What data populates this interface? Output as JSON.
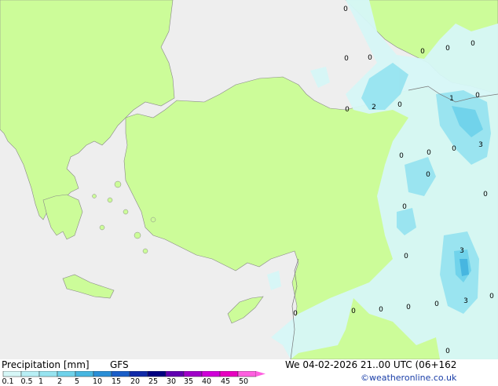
{
  "legend": {
    "title": "Precipitation [mm]",
    "model": "GFS",
    "ticks": [
      "0.1",
      "0.5",
      "1",
      "2",
      "5",
      "10",
      "15",
      "20",
      "25",
      "30",
      "35",
      "40",
      "45",
      "50"
    ],
    "colors": [
      "#d6f7f7",
      "#b8eff5",
      "#97e4f0",
      "#6fd2ea",
      "#47b6e0",
      "#2a8ed6",
      "#1a5ec8",
      "#102aa8",
      "#000080",
      "#6000b0",
      "#a000c8",
      "#d000d8",
      "#e800c0",
      "#ff60e0"
    ]
  },
  "run_info": {
    "datetime": "We 04-02-2026 21..00 UTC (06+162",
    "credit": "©weatheronline.co.uk"
  },
  "map": {
    "land_color": "#ccfc99",
    "sea_color": "#eeeeee",
    "outside_color": "#eeeeee",
    "labels": [
      {
        "text": "0"
      },
      {
        "text": "0"
      },
      {
        "text": "0"
      },
      {
        "text": "0"
      },
      {
        "text": "0"
      },
      {
        "text": "0"
      },
      {
        "text": "0"
      },
      {
        "text": "2"
      },
      {
        "text": "0"
      },
      {
        "text": "1"
      },
      {
        "text": "0"
      },
      {
        "text": "3"
      },
      {
        "text": "0"
      },
      {
        "text": "0"
      },
      {
        "text": "0"
      },
      {
        "text": "0"
      },
      {
        "text": "0"
      },
      {
        "text": "0"
      },
      {
        "text": "3"
      },
      {
        "text": "3"
      },
      {
        "text": "0"
      },
      {
        "text": "0"
      },
      {
        "text": "0"
      },
      {
        "text": "0"
      },
      {
        "text": "0"
      },
      {
        "text": "0"
      },
      {
        "text": "0"
      },
      {
        "text": "0"
      }
    ]
  }
}
